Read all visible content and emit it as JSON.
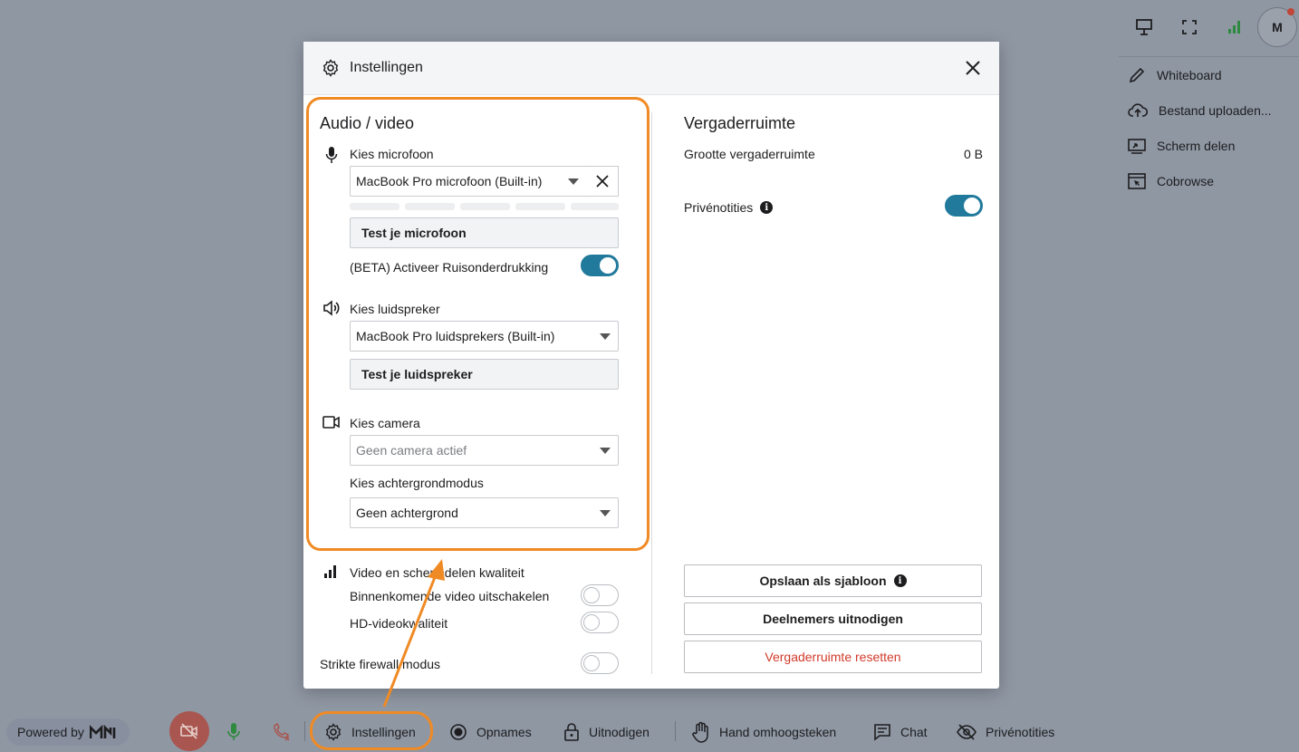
{
  "topbar": {
    "avatar_initial": "M",
    "icons": [
      "presentation-icon",
      "fullscreen-icon",
      "signal-bars-icon"
    ]
  },
  "side_menu": {
    "items": [
      {
        "label": "Whiteboard",
        "icon": "pencil-icon"
      },
      {
        "label": "Bestand uploaden...",
        "icon": "cloud-upload-icon"
      },
      {
        "label": "Scherm delen",
        "icon": "screen-share-icon"
      },
      {
        "label": "Cobrowse",
        "icon": "cobrowse-icon"
      }
    ]
  },
  "modal": {
    "title": "Instellingen",
    "audio_video": {
      "heading": "Audio / video",
      "mic_label": "Kies microfoon",
      "mic_value": "MacBook Pro microfoon (Built-in)",
      "test_mic": "Test je microfoon",
      "noise_label": "(BETA) Activeer Ruisonderdrukking",
      "noise_on": true,
      "speaker_label": "Kies luidspreker",
      "speaker_value": "MacBook Pro luidsprekers (Built-in)",
      "test_speaker": "Test je luidspreker",
      "camera_label": "Kies camera",
      "camera_value": "Geen camera actief",
      "bg_label": "Kies achtergrondmodus",
      "bg_value": "Geen achtergrond"
    },
    "quality": {
      "label": "Video en schermdelen kwaliteit",
      "incoming_label": "Binnenkomende video uitschakelen",
      "hd_label": "HD-videokwaliteit",
      "firewall_label": "Strikte firewall modus"
    },
    "room": {
      "heading": "Vergaderruimte",
      "size_label": "Grootte vergaderruimte",
      "size_value": "0 B",
      "private_notes_label": "Privénotities",
      "private_notes_on": true,
      "save_template": "Opslaan als sjabloon",
      "invite": "Deelnemers uitnodigen",
      "reset": "Vergaderruimte resetten"
    }
  },
  "bottom_bar": {
    "powered_by": "Powered by",
    "settings": "Instellingen",
    "recordings": "Opnames",
    "invite": "Uitnodigen",
    "raise_hand": "Hand omhoogsteken",
    "chat": "Chat",
    "private_notes": "Privénotities"
  },
  "colors": {
    "accent": "#217a9c",
    "highlight": "#f08a24",
    "danger": "#d23a2a"
  }
}
